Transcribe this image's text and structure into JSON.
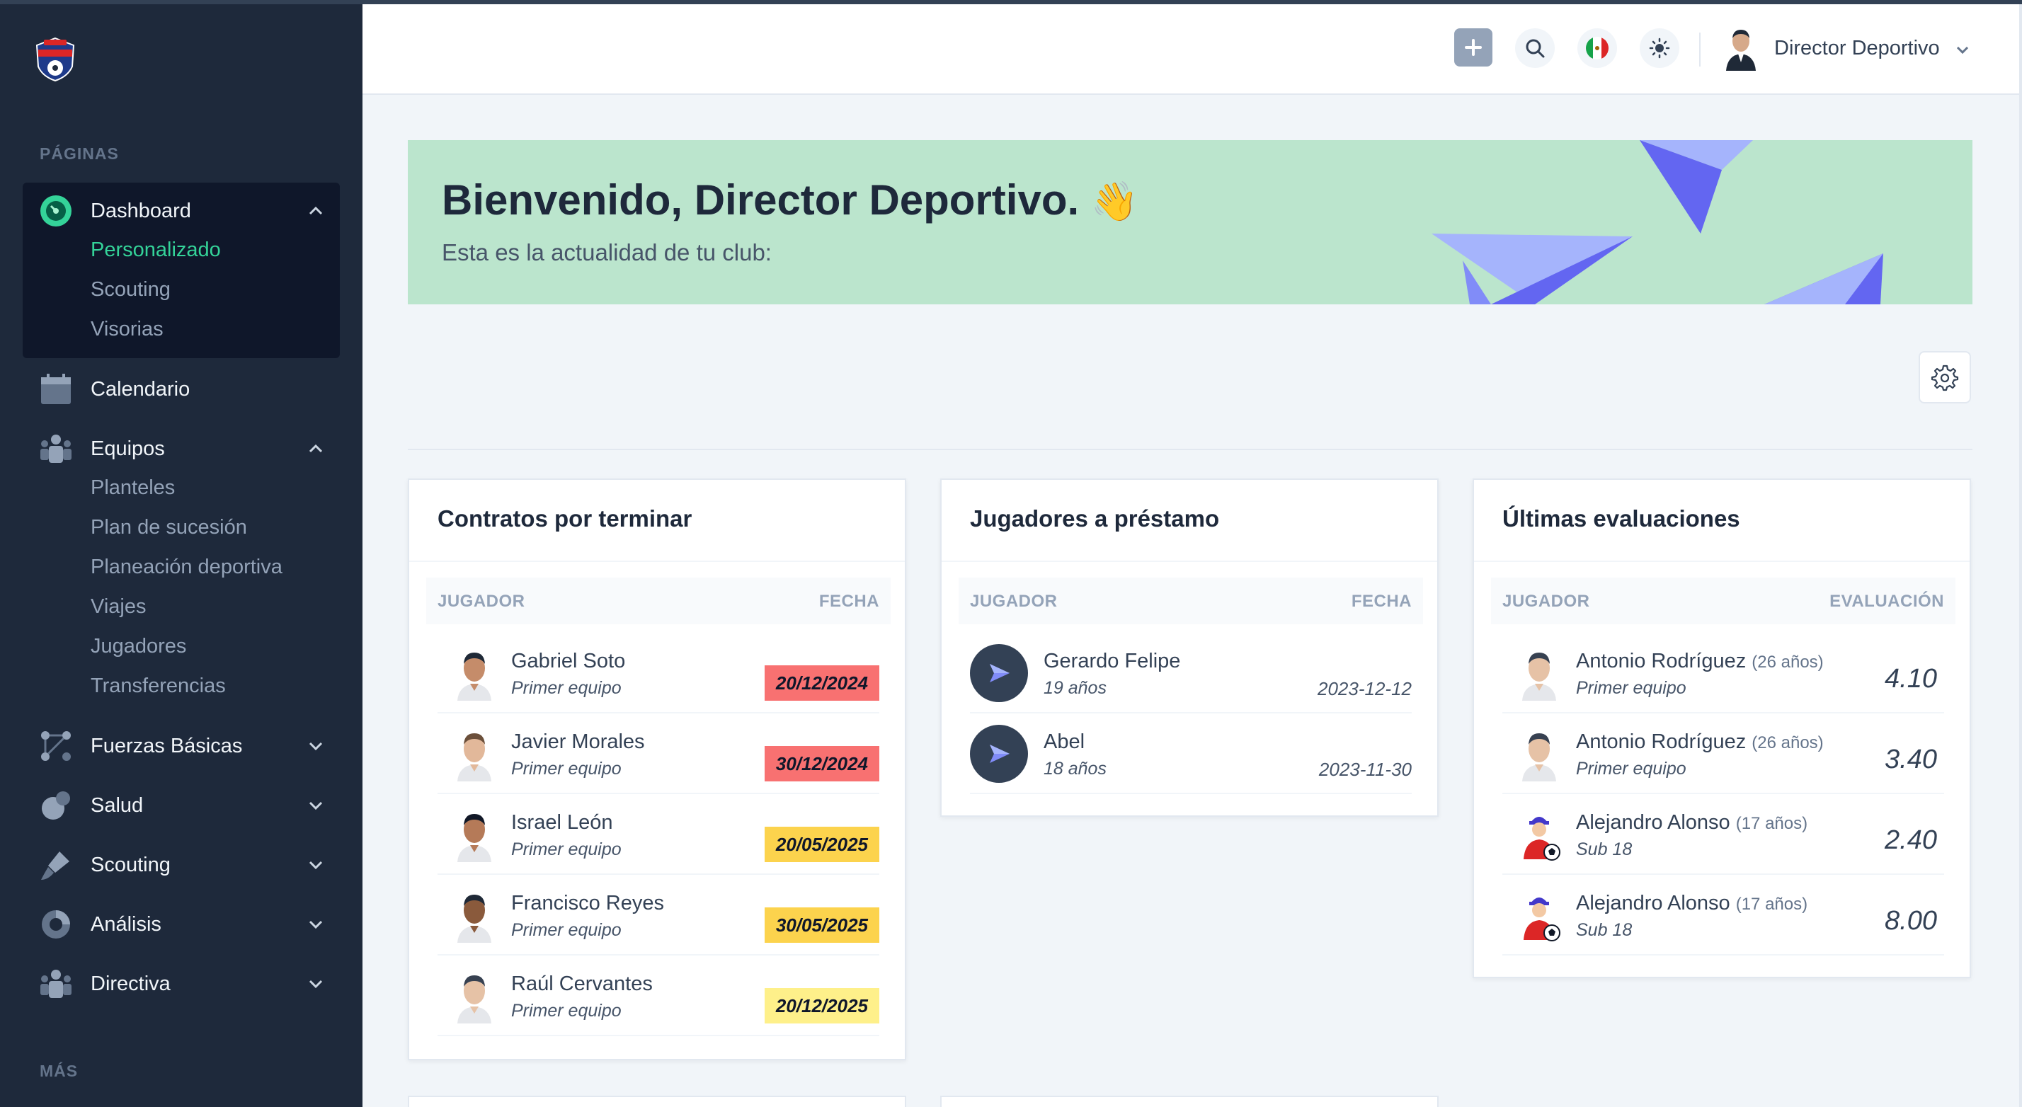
{
  "sidebar": {
    "pages_label": "PÁGINAS",
    "more_label": "MÁS",
    "dashboard": {
      "label": "Dashboard",
      "subitems": [
        "Personalizado",
        "Scouting",
        "Visorias"
      ]
    },
    "calendar": {
      "label": "Calendario"
    },
    "teams": {
      "label": "Equipos",
      "subitems": [
        "Planteles",
        "Plan de sucesión",
        "Planeación deportiva",
        "Viajes",
        "Jugadores",
        "Transferencias"
      ]
    },
    "collapsed": [
      "Fuerzas Básicas",
      "Salud",
      "Scouting",
      "Análisis",
      "Directiva"
    ]
  },
  "header": {
    "user_name": "Director Deportivo",
    "icons": [
      "plus-icon",
      "search-icon",
      "mexico-flag-icon",
      "sun-icon",
      "chevron-down-icon"
    ]
  },
  "banner": {
    "title": "Bienvenido, Director Deportivo.",
    "emoji": "👋",
    "subtitle": "Esta es la actualidad de tu club:"
  },
  "contracts": {
    "title": "Contratos por terminar",
    "col_player": "JUGADOR",
    "col_date": "FECHA",
    "rows": [
      {
        "name": "Gabriel Soto",
        "team": "Primer equipo",
        "date": "20/12/2024",
        "color": "#f87171"
      },
      {
        "name": "Javier Morales",
        "team": "Primer equipo",
        "date": "30/12/2024",
        "color": "#f87171"
      },
      {
        "name": "Israel León",
        "team": "Primer equipo",
        "date": "20/05/2025",
        "color": "#fcd34d"
      },
      {
        "name": "Francisco Reyes",
        "team": "Primer equipo",
        "date": "30/05/2025",
        "color": "#fcd34d"
      },
      {
        "name": "Raúl Cervantes",
        "team": "Primer equipo",
        "date": "20/12/2025",
        "color": "#fef08a"
      }
    ]
  },
  "loans": {
    "title": "Jugadores a préstamo",
    "col_player": "JUGADOR",
    "col_date": "FECHA",
    "rows": [
      {
        "name": "Gerardo Felipe",
        "age": "19 años",
        "date": "2023-12-12"
      },
      {
        "name": "Abel",
        "age": "18 años",
        "date": "2023-11-30"
      }
    ]
  },
  "evaluations": {
    "title": "Últimas evaluaciones",
    "col_player": "JUGADOR",
    "col_eval": "EVALUACIÓN",
    "rows": [
      {
        "name": "Antonio Rodríguez",
        "age": "(26 años)",
        "team": "Primer equipo",
        "score": "4.10"
      },
      {
        "name": "Antonio Rodríguez",
        "age": "(26 años)",
        "team": "Primer equipo",
        "score": "3.40"
      },
      {
        "name": "Alejandro Alonso",
        "age": "(17 años)",
        "team": "Sub 18",
        "score": "2.40"
      },
      {
        "name": "Alejandro Alonso",
        "age": "(17 años)",
        "team": "Sub 18",
        "score": "8.00"
      }
    ]
  },
  "colors": {
    "sidebar_bg": "#1e293b",
    "active_item": "#34d399",
    "banner_bg": "#bbe5cd",
    "accent": "#6366f1"
  }
}
